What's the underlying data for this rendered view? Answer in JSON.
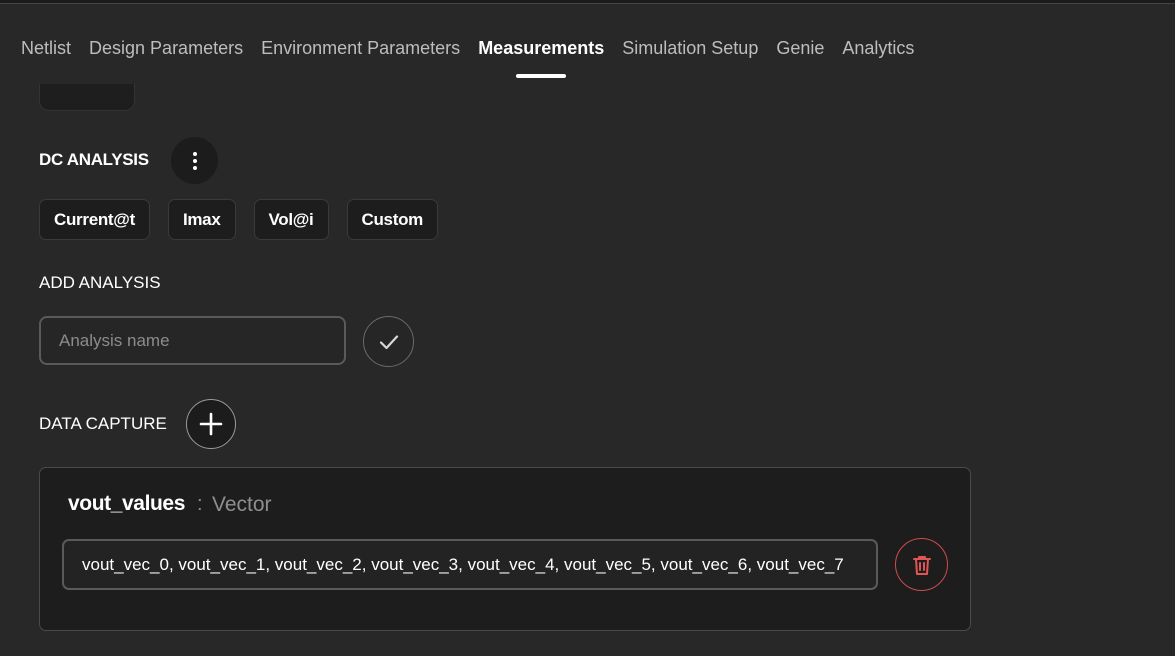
{
  "tabs": [
    {
      "label": "Netlist",
      "active": false
    },
    {
      "label": "Design Parameters",
      "active": false
    },
    {
      "label": "Environment Parameters",
      "active": false
    },
    {
      "label": "Measurements",
      "active": true
    },
    {
      "label": "Simulation Setup",
      "active": false
    },
    {
      "label": "Genie",
      "active": false
    },
    {
      "label": "Analytics",
      "active": false
    }
  ],
  "dc_analysis": {
    "title": "DC ANALYSIS",
    "more_icon": "more-vertical-icon",
    "chips": [
      "Current@t",
      "Imax",
      "Vol@i",
      "Custom"
    ]
  },
  "add_analysis": {
    "title": "ADD ANALYSIS",
    "placeholder": "Analysis name",
    "value": "",
    "confirm_icon": "check-icon"
  },
  "data_capture": {
    "title": "DATA CAPTURE",
    "add_icon": "plus-icon",
    "item": {
      "name": "vout_values",
      "separator": ":",
      "type": "Vector",
      "values": "vout_vec_0, vout_vec_1, vout_vec_2, vout_vec_3, vout_vec_4, vout_vec_5, vout_vec_6, vout_vec_7",
      "delete_icon": "trash-icon"
    }
  },
  "colors": {
    "background": "#282828",
    "active_tab": "#ffffff",
    "inactive_tab": "#bdbdbd",
    "delete_accent": "#e05555"
  }
}
